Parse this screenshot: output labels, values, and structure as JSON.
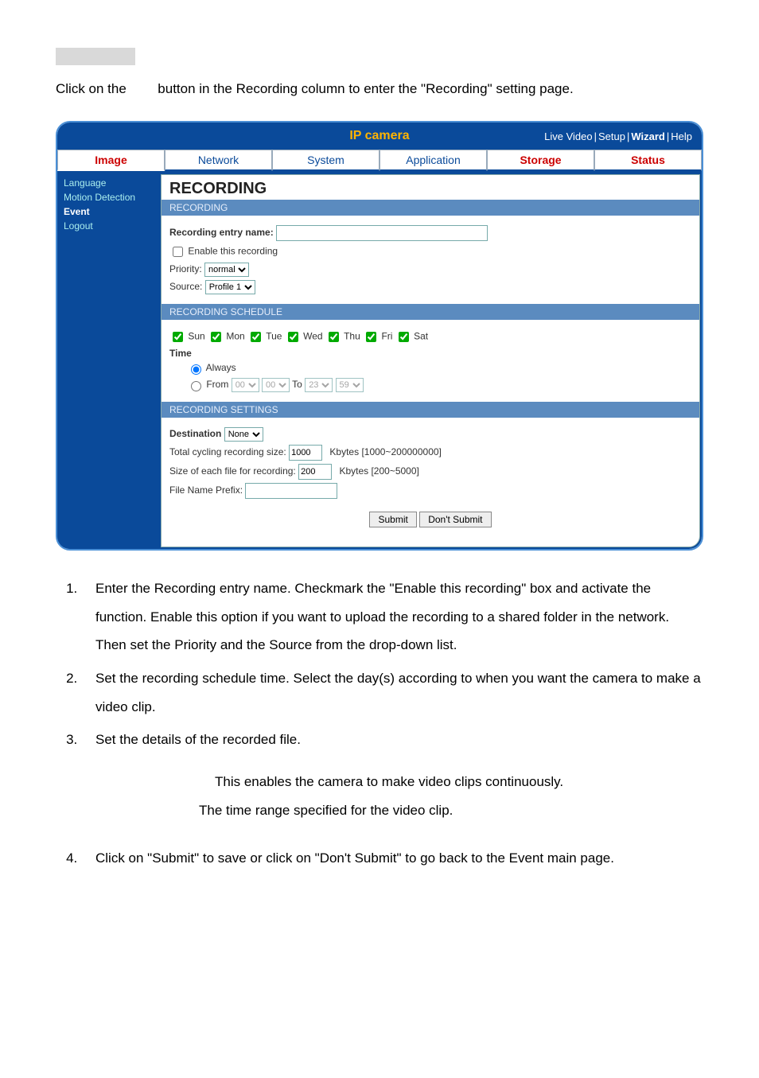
{
  "intro_before": "Click on the",
  "intro_after": "button in the Recording column to enter the \"Recording\" setting page.",
  "panel": {
    "title": "IP camera",
    "header_links": [
      "Live Video",
      "Setup",
      "Wizard",
      "Help"
    ],
    "tabs": [
      "Image",
      "Network",
      "System",
      "Application",
      "Storage",
      "Status"
    ],
    "sidebar": [
      "Language",
      "Motion Detection",
      "Event",
      "Logout"
    ],
    "main_title": "RECORDING",
    "sub1": "RECORDING",
    "entry_label": "Recording entry name:",
    "entry_value": "",
    "enable_label": "Enable this recording",
    "priority_label": "Priority:",
    "priority_value": "normal",
    "source_label": "Source:",
    "source_value": "Profile 1",
    "sub2": "RECORDING SCHEDULE",
    "days": [
      "Sun",
      "Mon",
      "Tue",
      "Wed",
      "Thu",
      "Fri",
      "Sat"
    ],
    "time_label": "Time",
    "always_label": "Always",
    "from_label": "From",
    "from_hh": "00",
    "from_mm": "00",
    "to_label": "To",
    "to_hh": "23",
    "to_mm": "59",
    "sub3": "RECORDING SETTINGS",
    "dest_label": "Destination",
    "dest_value": "None",
    "total_label": "Total cycling recording size:",
    "total_value": "1000",
    "total_range": "Kbytes [1000~200000000]",
    "each_label": "Size of each file for recording:",
    "each_value": "200",
    "each_range": "Kbytes [200~5000]",
    "prefix_label": "File Name Prefix:",
    "prefix_value": "",
    "submit": "Submit",
    "dont_submit": "Don't Submit"
  },
  "steps": [
    "Enter the Recording entry name. Checkmark the \"Enable this recording\" box and activate the function. Enable this option if you want to upload the recording to a shared folder in the network. Then set the Priority and the Source from the drop-down list.",
    "Set the recording schedule time. Select the day(s) according to when you want the camera to make a video clip.",
    "Set the details of the recorded file.",
    "Click on \"Submit\" to save or click on \"Don't Submit\" to go back to the Event main page."
  ],
  "sub_a": "This enables the camera to make video clips continuously.",
  "sub_b": "The time range specified for the video clip."
}
